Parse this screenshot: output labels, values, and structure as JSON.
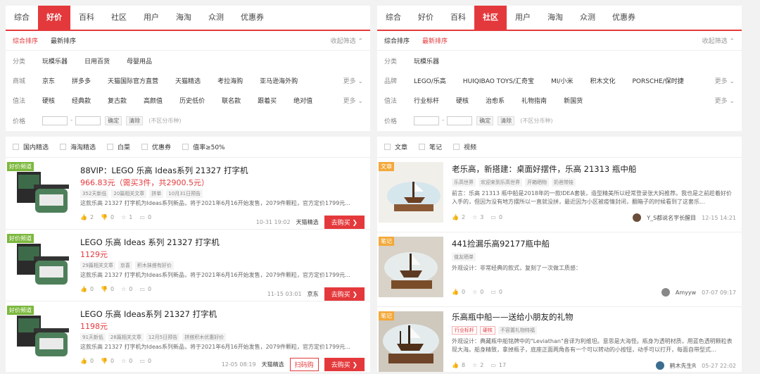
{
  "left": {
    "tabs": [
      "综合",
      "好价",
      "百科",
      "社区",
      "用户",
      "海淘",
      "众测",
      "优惠券"
    ],
    "active_tab": "好价",
    "sort": {
      "items": [
        "综合排序",
        "最新排序"
      ],
      "collapse": "收起筛选 ⌃"
    },
    "filters": {
      "category": {
        "label": "分类",
        "values": [
          "玩模乐器",
          "日用百货",
          "母婴用品"
        ]
      },
      "mall": {
        "label": "商城",
        "values": [
          "京东",
          "拼多多",
          "天猫国际官方直营",
          "天猫精选",
          "考拉海购",
          "亚马逊海外购"
        ],
        "more": "更多 ⌄"
      },
      "value": {
        "label": "值法",
        "values": [
          "硬核",
          "经典款",
          "复古款",
          "高颜值",
          "历史低价",
          "联名款",
          "跟着买",
          "绝对值"
        ],
        "more": "更多 ⌄"
      },
      "price": {
        "label": "价格",
        "confirm": "确定",
        "clear": "清除",
        "note": "(不区分币种)",
        "dash": "-"
      }
    },
    "checks": [
      "国内精选",
      "海淘精选",
      "白菜",
      "优惠券",
      "值率≥50%"
    ],
    "items": [
      {
        "badge": "好价频道",
        "title": "88VIP：LEGO 乐高 Ideas系列 21327 打字机",
        "price": "966.83元（需买3件，共2900.5元）",
        "tags": [
          "352天新低",
          "20篇相关文章",
          "拼单",
          "10月31日预告"
        ],
        "desc": "这款乐高 21327 打字机为Ideas系列新品，将于2021年6月16开始发售，2079件颗粒，官方定价1799元...",
        "stats": [
          "2",
          "0",
          "1",
          "0"
        ],
        "time": "10-31 19:02",
        "store": "天猫精选",
        "buy": "去购买 ❯"
      },
      {
        "badge": "好价频道",
        "title": "LEGO 乐高 Ideas 系列 21327 打字机",
        "price": "1129元",
        "tags": [
          "29篇相关文章",
          "京喜",
          "积木抹搭有好价"
        ],
        "desc": "这款乐高 21327 打字机为Ideas系列新品，将于2021年6月16开始发售，2079件颗粒，官方定价1799元...",
        "stats": [
          "0",
          "0",
          "0",
          "0"
        ],
        "time": "11-15 03:01",
        "store": "京东",
        "buy": "去购买 ❯"
      },
      {
        "badge": "好价频道",
        "title": "LEGO 乐高 Ideas系列 21327 打字机",
        "price": "1198元",
        "tags": [
          "91天新低",
          "28篇相关文章",
          "12月5日预告",
          "拼搭积木优惠好价"
        ],
        "desc": "这款乐高 21327 打字机为Ideas系列新品，将于2021年6月16开始发售，2079件颗粒，官方定价1799元...",
        "stats": [
          "0",
          "0",
          "0",
          "0"
        ],
        "time": "12-05 08:19",
        "store": "天猫精选",
        "scan": "扫码购",
        "buy": "去购买 ❯"
      }
    ]
  },
  "right": {
    "tabs": [
      "综合",
      "好价",
      "百科",
      "社区",
      "用户",
      "海淘",
      "众测",
      "优惠券"
    ],
    "active_tab": "社区",
    "sort": {
      "items": [
        "综合排序",
        "最新排序"
      ],
      "collapse": "收起筛选 ⌃"
    },
    "filters": {
      "category": {
        "label": "分类",
        "values": [
          "玩模乐器"
        ]
      },
      "brand": {
        "label": "品牌",
        "values": [
          "LEGO/乐高",
          "HUIQIBAO TOYS/汇奇宝",
          "MI/小米",
          "积木文化",
          "PORSCHE/保时捷"
        ],
        "more": "更多 ⌄"
      },
      "value": {
        "label": "值法",
        "values": [
          "行业标杆",
          "硬核",
          "治愈系",
          "礼物指南",
          "新国货"
        ],
        "more": "更多 ⌄"
      },
      "price": {
        "label": "价格",
        "confirm": "确定",
        "clear": "清除",
        "note": "(不区分币种)",
        "dash": "-"
      }
    },
    "checks": [
      "文章",
      "笔记",
      "视频"
    ],
    "items": [
      {
        "badge": "文章",
        "title": "老乐高，新搭建：桌面好摆件，乐高 21313 瓶中船",
        "tags": [
          "乐高世界",
          "欢迎来到乐高世界",
          "开箱晒物",
          "奶爸带娃"
        ],
        "desc": "前言：乐高 21313 瓶中船是2018年的一款IDEA套装，造型精美所以经常登录张大妈推荐。我也是之前趁着好价入手的，但因为没有地方摆所以一直就没拼，最近因为小区被疫情封闭，翻箱子的时候看到了这套乐...",
        "stats": [
          "2",
          "3",
          "0"
        ],
        "user": "Y_S都说名字长醒目",
        "time": "12-15 14:21"
      },
      {
        "badge": "笔记",
        "title": "441捡漏乐高92177瓶中船",
        "tags": [
          "值友晒单"
        ],
        "desc": "外观设计：非常经典的款式，复刻了一次做工质感：",
        "stats": [
          "0",
          "0",
          "0"
        ],
        "user": "Amyyw",
        "time": "07-07 09:17"
      },
      {
        "badge": "笔记",
        "title": "乐高瓶中船——送给小朋友的礼物",
        "rtags": [
          "行业标杆",
          "硬核"
        ],
        "tags": [
          "不容置礼物特福"
        ],
        "desc": "外观设计：典藏瓶中船铭牌中的\"Leviathan\"音译为利维坦。意思是大海怪。瓶身为透明材质，用蓝色透明颗粒表现大海。船身精致，拿掉瓶子，底座正面两角各有一个可以转动的小按钮，动手可以打开，每面自带型式...",
        "stats": [
          "8",
          "2",
          "17"
        ],
        "user": "鹤木先生R",
        "time": "05-27 22:02"
      }
    ]
  }
}
